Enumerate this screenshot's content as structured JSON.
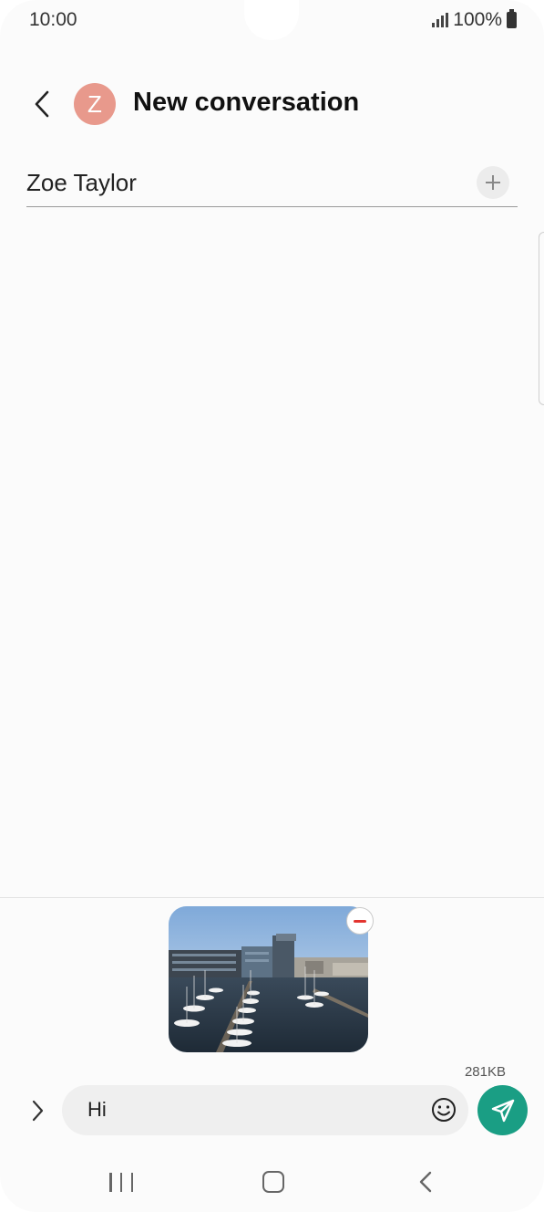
{
  "status_bar": {
    "time": "10:00",
    "battery": "100%",
    "icons": [
      "signal-icon",
      "battery-icon"
    ]
  },
  "header": {
    "back_icon": "chevron-left-icon",
    "avatar_letter": "Z",
    "avatar_color": "#e8998c",
    "title": "New conversation"
  },
  "recipient": {
    "name": "Zoe Taylor",
    "add_icon": "plus-icon"
  },
  "attachment": {
    "type": "photo",
    "subject": "harbour-with-boats-and-buildings",
    "remove_icon": "minus-icon",
    "remove_color": "#e3342f",
    "size": "281KB"
  },
  "composer": {
    "expand_icon": "chevron-right-icon",
    "message": "Hi",
    "emoji_icon": "smiley-icon",
    "send_icon": "paper-plane-icon",
    "send_color": "#1a9e84"
  },
  "nav_bar": {
    "icons": [
      "recent-apps-icon",
      "home-icon",
      "back-icon"
    ]
  }
}
